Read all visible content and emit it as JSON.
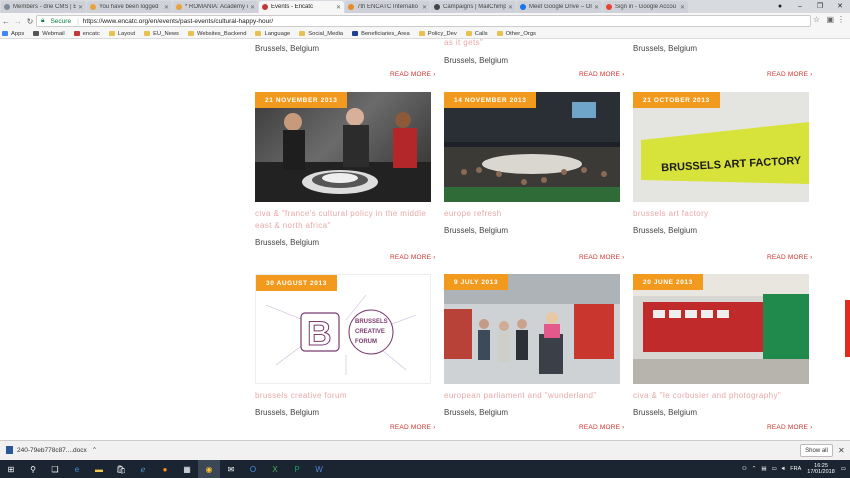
{
  "browser": {
    "tabs": [
      {
        "label": "Members - drie CMS | E",
        "icon_color": "#7d8a99"
      },
      {
        "label": "You have been logged",
        "icon_color": "#e9a23b"
      },
      {
        "label": "* ROMANIA: Academy o",
        "icon_color": "#e9a23b"
      },
      {
        "label": "Events - Encatc",
        "icon_color": "#c03a3a",
        "active": true
      },
      {
        "label": "7th ENCATC Internatio",
        "icon_color": "#e58a24"
      },
      {
        "label": "Campaigns | MailChimp",
        "icon_color": "#444"
      },
      {
        "label": "Meet Google Drive – On",
        "icon_color": "#1a73e8"
      },
      {
        "label": "Sign in - Google Accou",
        "icon_color": "#ea4335"
      }
    ],
    "secure_label": "Secure",
    "url": "https://www.encatc.org/en/events/past-events/cultural-happy-hour/",
    "bookmarks": [
      {
        "label": "Apps",
        "color": "#4285f4"
      },
      {
        "label": "Webmail",
        "color": "#555"
      },
      {
        "label": "encatc",
        "color": "#c03a3a"
      },
      {
        "label": "Layout",
        "color": "#e7c250"
      },
      {
        "label": "EU_News",
        "color": "#e7c250"
      },
      {
        "label": "Websites_Backend",
        "color": "#e7c250"
      },
      {
        "label": "Language",
        "color": "#e7c250"
      },
      {
        "label": "Social_Media",
        "color": "#e7c250"
      },
      {
        "label": "Beneficiaries_Area",
        "color": "#1f3f99"
      },
      {
        "label": "Policy_Dev",
        "color": "#e7c250"
      },
      {
        "label": "Calls",
        "color": "#e7c250"
      },
      {
        "label": "Other_Orgs",
        "color": "#e7c250"
      }
    ]
  },
  "events": {
    "read_more": "READ MORE",
    "top_row": [
      {
        "city": "Brussels, Belgium",
        "title_tail": ""
      },
      {
        "city": "Brussels, Belgium",
        "title_tail": "as it gets\""
      },
      {
        "city": "Brussels, Belgium",
        "title_tail": ""
      }
    ],
    "middle_row": [
      {
        "date": "21 NOVEMBER 2013",
        "title": "civa & \"france's cultural policy in the middle east & north africa\"",
        "city": "Brussels, Belgium"
      },
      {
        "date": "14 NOVEMBER 2013",
        "title": "europe refresh",
        "city": "Brussels, Belgium"
      },
      {
        "date": "21 OCTOBER 2013",
        "title": "brussels art factory",
        "city": "Brussels, Belgium",
        "image_text": "BRUSSELS ART FACTORY"
      }
    ],
    "bottom_row": [
      {
        "date": "30 AUGUST 2013",
        "title": "brussels creative forum",
        "city": "Brussels, Belgium",
        "image_text": [
          "BRUSSELS",
          "CREATIVE",
          "FORUM"
        ]
      },
      {
        "date": "9 JULY 2013",
        "title": "european parliament and \"wunderland\"",
        "city": "Brussels, Belgium"
      },
      {
        "date": "20 JUNE 2013",
        "title": "civa & \"le corbusier and photography\"",
        "city": "Brussels, Belgium"
      }
    ]
  },
  "download_bar": {
    "file": "240-79eb778c87....docx",
    "show_all": "Show all"
  },
  "taskbar": {
    "language": "FRA",
    "time": "16:25",
    "date": "17/01/2018"
  },
  "colors": {
    "accent": "#d0322c",
    "date_badge": "#f29a1d",
    "title": "#e9a8a8"
  }
}
